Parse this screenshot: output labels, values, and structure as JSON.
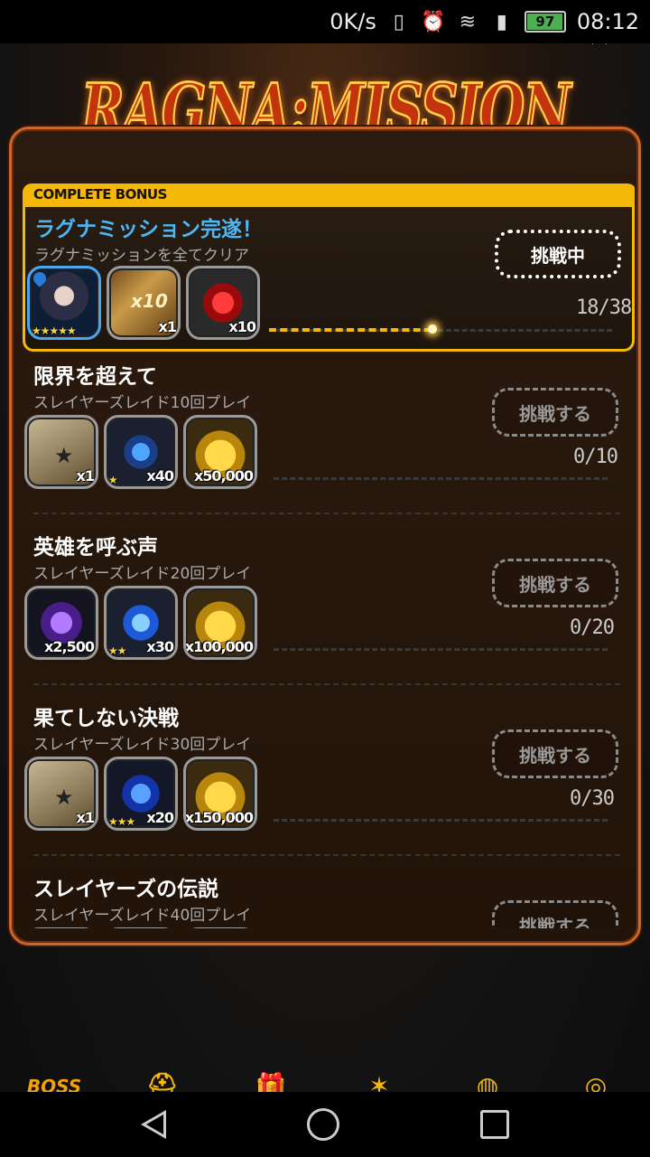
{
  "status_bar": {
    "speed": "0K/s",
    "battery": "97",
    "battery_level": 0.97,
    "time": "08:12"
  },
  "logo": {
    "text": "RAGNA:MISSION"
  },
  "close": {
    "icon": "close-icon",
    "glyph": "^"
  },
  "bonus": {
    "tab_label": "COMPLETE BONUS",
    "title": "ラグナミッション完遂！",
    "subtitle": "ラグナミッションを全てクリア",
    "button": "挑戦中",
    "progress": "18/38",
    "progress_current": 18,
    "progress_total": 38,
    "rewards": [
      {
        "icon": "hero-portrait-icon",
        "qty": "",
        "stars": "★★★★★"
      },
      {
        "icon": "gacha-ticket-icon",
        "qty": "x1",
        "stars": ""
      },
      {
        "icon": "red-crystal-icon",
        "qty": "x10",
        "stars": ""
      }
    ]
  },
  "missions": [
    {
      "title": "限界を超えて",
      "subtitle": "スレイヤーズレイド10回プレイ",
      "button": "挑戦する",
      "progress": "0/10",
      "rewards": [
        {
          "icon": "card-icon",
          "qty": "x1",
          "stars": ""
        },
        {
          "icon": "blue-orb-icon",
          "qty": "x40",
          "stars": "★"
        },
        {
          "icon": "gold-coins-icon",
          "qty": "x50,000",
          "stars": ""
        }
      ]
    },
    {
      "title": "英雄を呼ぶ声",
      "subtitle": "スレイヤーズレイド20回プレイ",
      "button": "挑戦する",
      "progress": "0/20",
      "rewards": [
        {
          "icon": "purple-gem-icon",
          "qty": "x2,500",
          "stars": ""
        },
        {
          "icon": "blue-crystal-icon",
          "qty": "x30",
          "stars": "★★"
        },
        {
          "icon": "gold-coins-icon",
          "qty": "x100,000",
          "stars": ""
        }
      ]
    },
    {
      "title": "果てしない決戦",
      "subtitle": "スレイヤーズレイド30回プレイ",
      "button": "挑戦する",
      "progress": "0/30",
      "rewards": [
        {
          "icon": "card-icon",
          "qty": "x1",
          "stars": ""
        },
        {
          "icon": "blue-gem-icon",
          "qty": "x20",
          "stars": "★★★"
        },
        {
          "icon": "gold-coins-icon",
          "qty": "x150,000",
          "stars": ""
        }
      ]
    },
    {
      "title": "スレイヤーズの伝説",
      "subtitle": "スレイヤーズレイド40回プレイ",
      "button": "挑戦する",
      "progress": "",
      "rewards": []
    }
  ],
  "bottom_nav": [
    {
      "label": "BOSS",
      "icon": "boss-icon"
    },
    {
      "label": "",
      "icon": "helmet-icon"
    },
    {
      "label": "",
      "icon": "gift-icon"
    },
    {
      "label": "",
      "icon": "star-swords-icon"
    },
    {
      "label": "",
      "icon": "globe-icon"
    },
    {
      "label": "",
      "icon": "compass-icon"
    }
  ],
  "colors": {
    "accent": "#f3b80a",
    "bonus_title": "#4db6f5",
    "panel_border": "#c8682c"
  }
}
